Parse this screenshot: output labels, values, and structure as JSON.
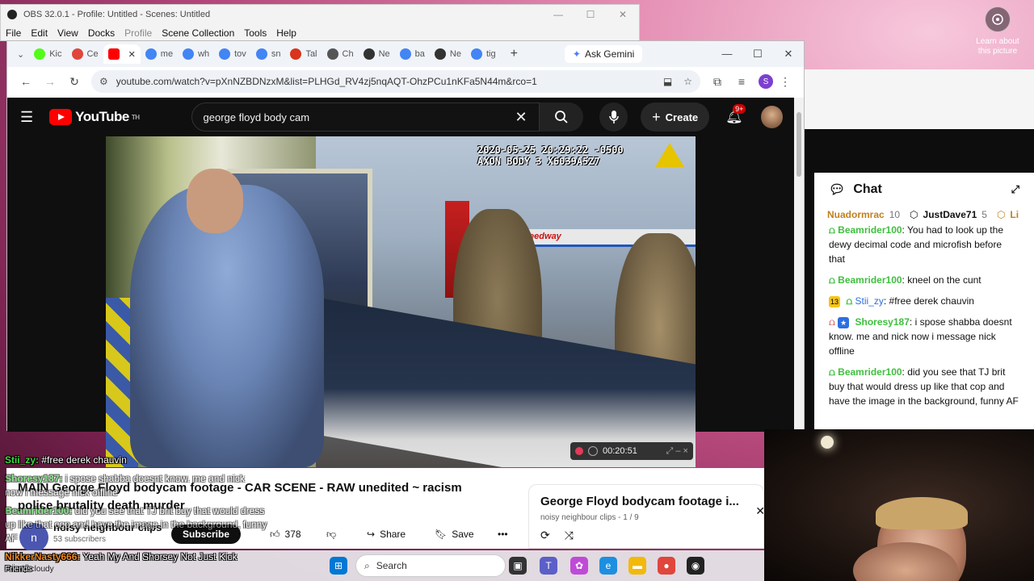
{
  "desktop": {
    "learn_label": "Learn about this picture"
  },
  "obs": {
    "title": "OBS 32.0.1 - Profile: Untitled - Scenes: Untitled",
    "menu": [
      "File",
      "Edit",
      "View",
      "Docks",
      "Profile",
      "Scene Collection",
      "Tools",
      "Help"
    ]
  },
  "chrome": {
    "tabs": [
      {
        "label": "Kic",
        "color": "#53fc18"
      },
      {
        "label": "Ce",
        "color": "#e0463b"
      },
      {
        "label": "",
        "color": "#ff0000",
        "active": true
      },
      {
        "label": "me",
        "color": "#4285f4"
      },
      {
        "label": "wh",
        "color": "#4285f4"
      },
      {
        "label": "tov",
        "color": "#4285f4"
      },
      {
        "label": "sn",
        "color": "#4285f4"
      },
      {
        "label": "Tal",
        "color": "#d9341c"
      },
      {
        "label": "Ch",
        "color": "#555555"
      },
      {
        "label": "Ne",
        "color": "#333333"
      },
      {
        "label": "ba",
        "color": "#4285f4"
      },
      {
        "label": "Ne",
        "color": "#333333"
      },
      {
        "label": "tig",
        "color": "#4285f4"
      }
    ],
    "ask_gemini": "Ask Gemini",
    "url": "youtube.com/watch?v=pXnNZBDNzxM&list=PLHGd_RV4zj5nqAQT-OhzPCu1nKFa5N44m&rco=1",
    "profile_initial": "S"
  },
  "youtube": {
    "logo_text": "YouTube",
    "logo_sup": "TH",
    "search_value": "george floyd body cam",
    "create_label": "Create",
    "notif_badge": "9+",
    "video_stamp_line1": "2020-05-25 20:29:22 -0500",
    "video_stamp_line2": "AXON BODY 3 X6039A5Z7",
    "store_sign": "Speedway",
    "video_title_line1": "MAIN George Floyd bodycam footage - CAR SCENE - RAW unedited ~ racism",
    "video_title_line2": "police brutality death murder",
    "channel_initial": "n",
    "channel_name": "noisy neighbour clips",
    "channel_subs": "53 subscribers",
    "subscribe_label": "Subscribe",
    "likes": "378",
    "share_label": "Share",
    "save_label": "Save",
    "playlist_title": "George Floyd bodycam footage i...",
    "playlist_sub": "noisy neighbour clips - 1 / 9"
  },
  "recorder": {
    "time": "00:20:51"
  },
  "chat": {
    "title": "Chat",
    "top_users": [
      {
        "name": "Nuadormrac",
        "count": "10"
      },
      {
        "name": "JustDave71",
        "count": "5"
      },
      {
        "name": "Li",
        "count": ""
      }
    ],
    "messages": [
      {
        "user": "Beamrider100",
        "text": "You had to look up the dewy decimal code and microfish before that",
        "color": "#3fbf3f"
      },
      {
        "user": "Beamrider100",
        "text": "kneel on the cunt",
        "color": "#3fbf3f"
      },
      {
        "user": "Stii_zy",
        "text": "#free derek chauvin",
        "color": "#2c6fe0",
        "badge": "13"
      },
      {
        "user": "Shoresy187",
        "text": "i spose shabba doesnt know. me and nick now i message nick offline",
        "color": "#3fbf3f"
      },
      {
        "user": "Beamrider100",
        "text": "did you see that TJ brit buy that would dress up like that cop and have the image in the background, funny AF",
        "color": "#3fbf3f"
      }
    ]
  },
  "overlay": {
    "l1_user": "Stii_zy:",
    "l1_text": "#free derek chauvin",
    "l2_user": "Shoresy187:",
    "l2_text": "i spose shabba doesnt know. me and nick",
    "l2b_text": "now i message nick offline",
    "l3_user": "Beamrider100:",
    "l3_text": "did you see that TJ brit buy that would dress",
    "l3b_text": "up like that cop and have the image in the background, funny",
    "l3c_text": "AF",
    "l4_user": "NikkerNasty666:",
    "l4_text": "Yeah My And Shorsey Not Just Kick",
    "l4b_text": "Friends"
  },
  "taskbar": {
    "weather": "Mostly cloudy",
    "search_placeholder": "Search"
  }
}
